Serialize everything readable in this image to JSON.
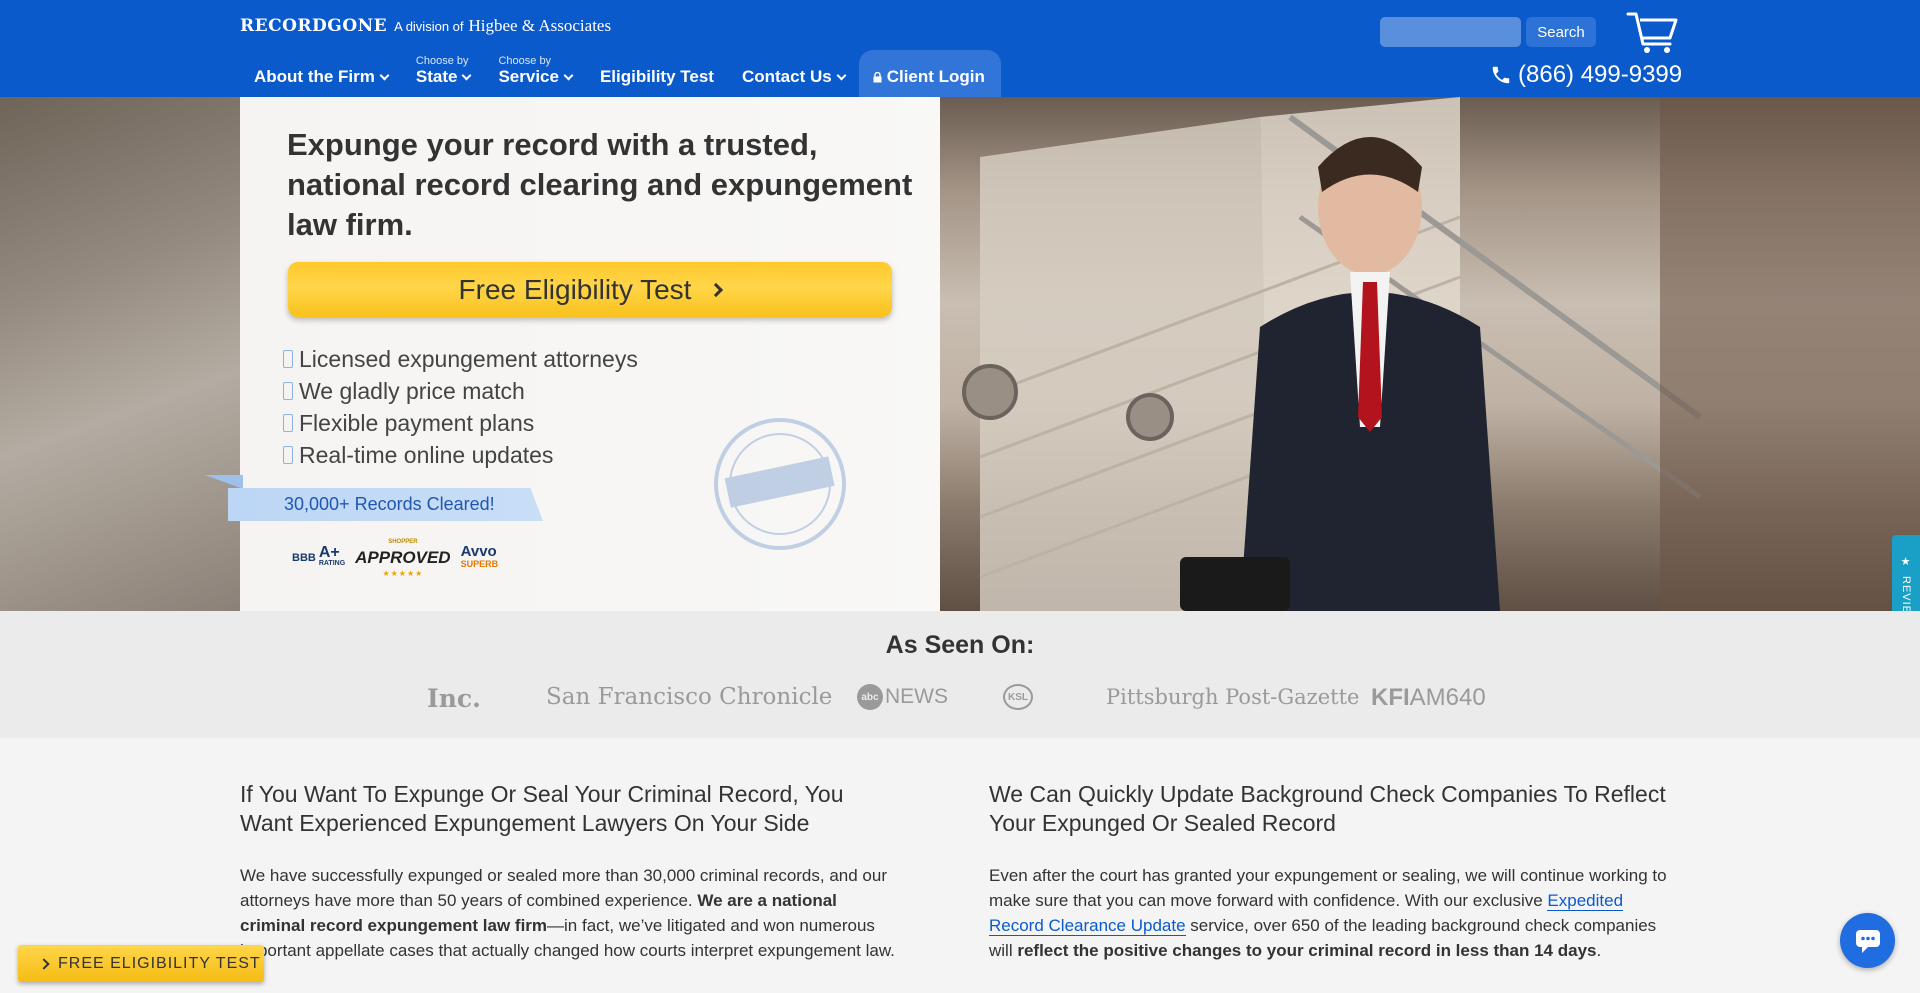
{
  "header": {
    "logo_main": "RECORDGONE",
    "logo_division": "A division of",
    "logo_firm": "Higbee & Associates",
    "search_placeholder": "",
    "search_button": "Search",
    "phone": "(866) 499-9399",
    "brand_color": "#0b5acb"
  },
  "nav": {
    "about": "About the Firm",
    "state_small": "Choose by",
    "state": "State",
    "service_small": "Choose by",
    "service": "Service",
    "eligibility": "Eligibility Test",
    "contact": "Contact Us",
    "login": "Client Login"
  },
  "hero": {
    "h1_a": "Expunge your record",
    "h1_b": " with a trusted, national ",
    "h1_c": "record clearing",
    "h1_d": " and ",
    "h1_e": "expungement",
    "h1_f": " law firm.",
    "cta": "Free Eligibility Test",
    "features": [
      "Licensed expungement attorneys",
      "We gladly price match",
      "Flexible payment plans",
      "Real-time online updates"
    ],
    "ribbon": "30,000+ Records Cleared!",
    "badges": {
      "bbb_a": "BBB",
      "bbb_b": "A+",
      "bbb_c": "RATING",
      "approved_top": "SHOPPER",
      "approved": "APPROVED",
      "avvo": "Avvo",
      "avvo_sup": "SUPERB"
    }
  },
  "reviews_tab": "REVIEWS",
  "seen": {
    "title": "As Seen On:",
    "logos": {
      "inc": "Inc.",
      "sfc": "San Francisco Chronicle",
      "abc": "abc",
      "abc_news": "NEWS",
      "ksl": "KSL",
      "ppg": "Pittsburgh Post-Gazette",
      "kfi": "KFI",
      "kfi_am": "AM640"
    }
  },
  "content": {
    "left_h2": "If You Want To Expunge Or Seal Your Criminal Record, You Want Experienced Expungement Lawyers On Your Side",
    "left_p1": "We have successfully expunged or sealed more than 30,000 criminal records, and our attorneys have more than 50 years of combined experience. ",
    "left_p_bold": "We are a national criminal record expungement law firm",
    "left_p2": "—in fact, we’ve litigated and won numerous important appellate cases that actually changed how courts interpret expungement law.",
    "right_h2": "We Can Quickly Update Background Check Companies To Reflect Your Expunged Or Sealed Record",
    "right_p1": "Even after the court has granted your expungement or sealing, we will continue working to make sure that you can move forward with confidence. With our exclusive ",
    "right_link": "Expedited Record Clearance Update",
    "right_p2": " service, over 650 of the leading background check companies will ",
    "right_p_bold": "reflect the positive changes to your criminal record in less than 14 days",
    "right_p3": "."
  },
  "float_cta": "FREE ELIGIBILITY TEST"
}
